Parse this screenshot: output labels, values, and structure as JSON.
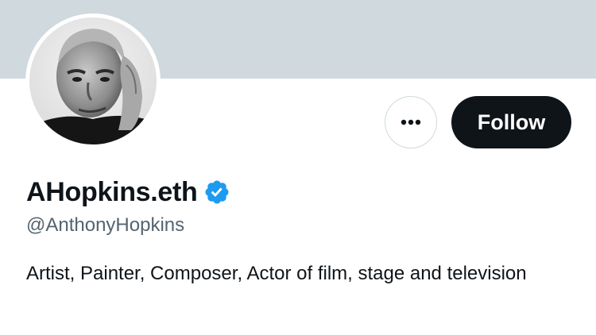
{
  "profile": {
    "display_name": "AHopkins.eth",
    "handle": "@AnthonyHopkins",
    "bio": "Artist, Painter, Composer, Actor of film, stage and television",
    "verified": true,
    "verified_icon": "verified-badge-icon"
  },
  "actions": {
    "follow_label": "Follow",
    "more_icon": "more-options-icon"
  },
  "colors": {
    "banner": "#cfd9de",
    "follow_bg": "#0f1419",
    "follow_text": "#ffffff",
    "verified": "#1d9bf0",
    "handle_text": "#536471",
    "primary_text": "#0f1419"
  }
}
